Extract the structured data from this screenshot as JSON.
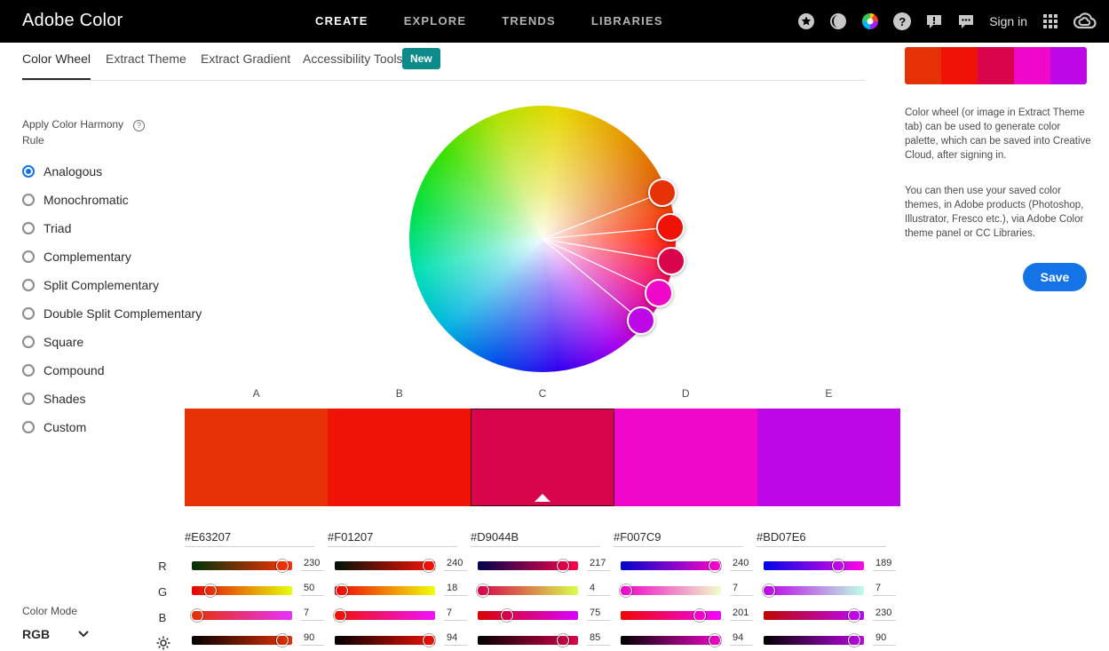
{
  "app": {
    "title": "Adobe Color"
  },
  "nav": {
    "items": [
      "CREATE",
      "EXPLORE",
      "TRENDS",
      "LIBRARIES"
    ],
    "active": 0
  },
  "topbar": {
    "sign_in": "Sign in",
    "help": "?",
    "feedback": "!"
  },
  "tabs": {
    "items": [
      "Color Wheel",
      "Extract Theme",
      "Extract Gradient",
      "Accessibility Tools"
    ],
    "active": 0,
    "new_badge": "New"
  },
  "harmony": {
    "label": "Apply Color Harmony Rule",
    "help": "?",
    "rules": [
      "Analogous",
      "Monochromatic",
      "Triad",
      "Complementary",
      "Split Complementary",
      "Double Split Complementary",
      "Square",
      "Compound",
      "Shades",
      "Custom"
    ],
    "selected": "Analogous"
  },
  "color_mode": {
    "label": "Color Mode",
    "value": "RGB"
  },
  "swatches": [
    {
      "label": "A",
      "hex": "#E63207",
      "color": "#E63207",
      "r": "230",
      "g": "50",
      "b": "7",
      "brightness": "90",
      "r_pct": 90,
      "g_pct": 19,
      "b_pct": 3,
      "br_pct": 90
    },
    {
      "label": "B",
      "hex": "#F01207",
      "color": "#F01207",
      "r": "240",
      "g": "18",
      "b": "7",
      "brightness": "94",
      "r_pct": 94,
      "g_pct": 7,
      "b_pct": 3,
      "br_pct": 94
    },
    {
      "label": "C",
      "hex": "#D9044B",
      "color": "#D9044B",
      "r": "217",
      "g": "4",
      "b": "75",
      "brightness": "85",
      "r_pct": 85,
      "g_pct": 2,
      "b_pct": 29,
      "br_pct": 85
    },
    {
      "label": "D",
      "hex": "#F007C9",
      "color": "#F007C9",
      "r": "240",
      "g": "7",
      "b": "201",
      "brightness": "94",
      "r_pct": 94,
      "g_pct": 3,
      "b_pct": 79,
      "br_pct": 94
    },
    {
      "label": "E",
      "hex": "#BD07E6",
      "color": "#BD07E6",
      "r": "189",
      "g": "7",
      "b": "230",
      "brightness": "90",
      "r_pct": 74,
      "g_pct": 3,
      "b_pct": 90,
      "br_pct": 90
    }
  ],
  "selected_swatch": "C",
  "channels": {
    "r": "R",
    "g": "G",
    "b": "B"
  },
  "description": {
    "p1": "Color wheel (or image in Extract Theme tab) can be used to generate color palette, which can be saved into Creative Cloud, after signing in.",
    "p2": "You can then use your saved color themes, in Adobe products (Photoshop, Illustrator, Fresco etc.), via Adobe Color theme panel or CC Libraries."
  },
  "save_label": "Save"
}
